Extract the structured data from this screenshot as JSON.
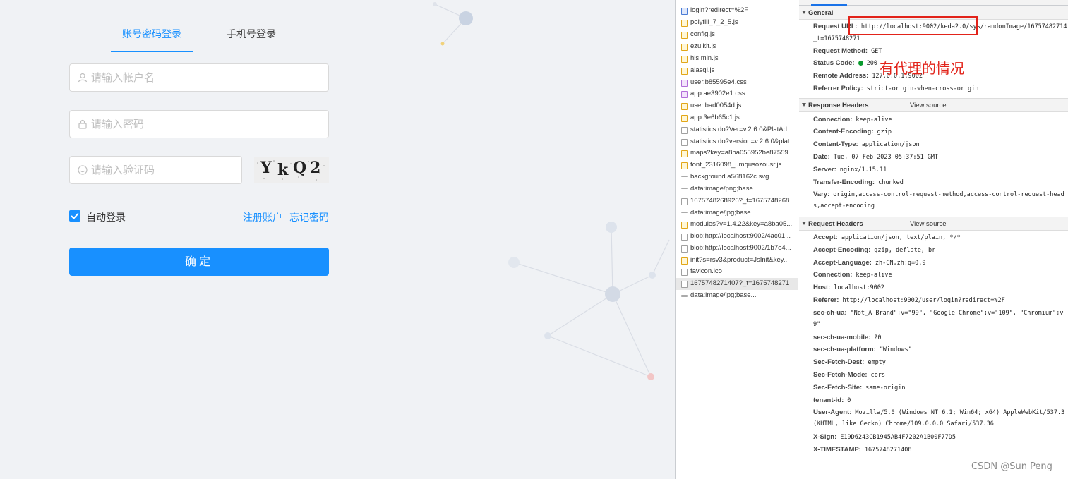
{
  "login": {
    "tabs": [
      {
        "label": "账号密码登录",
        "active": true
      },
      {
        "label": "手机号登录",
        "active": false
      }
    ],
    "username": {
      "placeholder": "请输入帐户名",
      "value": ""
    },
    "password": {
      "placeholder": "请输入密码",
      "value": ""
    },
    "captcha": {
      "placeholder": "请输入验证码",
      "value": "",
      "image_text": [
        "Y",
        "k",
        "Q",
        "2"
      ]
    },
    "remember": {
      "label": "自动登录",
      "checked": true
    },
    "register_link": "注册账户",
    "forgot_link": "忘记密码",
    "submit_label": "确定",
    "accent_color": "#1890ff"
  },
  "devtools": {
    "requests": [
      {
        "name": "login?redirect=%2F",
        "type": "doc"
      },
      {
        "name": "polyfill_7_2_5.js",
        "type": "script"
      },
      {
        "name": "config.js",
        "type": "script"
      },
      {
        "name": "ezuikit.js",
        "type": "script"
      },
      {
        "name": "hls.min.js",
        "type": "script"
      },
      {
        "name": "alasql.js",
        "type": "script"
      },
      {
        "name": "user.b85595e4.css",
        "type": "style"
      },
      {
        "name": "app.ae3902e1.css",
        "type": "style"
      },
      {
        "name": "user.bad0054d.js",
        "type": "script"
      },
      {
        "name": "app.3e6b65c1.js",
        "type": "script"
      },
      {
        "name": "statistics.do?Ver=v.2.6.0&PlatAd...",
        "type": "other"
      },
      {
        "name": "statistics.do?version=v.2.6.0&plat...",
        "type": "other"
      },
      {
        "name": "maps?key=a8ba055952be87559...",
        "type": "script"
      },
      {
        "name": "font_2316098_umqusozousr.js",
        "type": "script"
      },
      {
        "name": "background.a568162c.svg",
        "type": "img"
      },
      {
        "name": "data:image/png;base...",
        "type": "img"
      },
      {
        "name": "1675748268926?_t=1675748268",
        "type": "other"
      },
      {
        "name": "data:image/jpg;base...",
        "type": "img"
      },
      {
        "name": "modules?v=1.4.22&key=a8ba05...",
        "type": "script"
      },
      {
        "name": "blob:http://localhost:9002/4ac01...",
        "type": "other"
      },
      {
        "name": "blob:http://localhost:9002/1b7e4...",
        "type": "other"
      },
      {
        "name": "init?s=rsv3&product=JsInit&key...",
        "type": "script"
      },
      {
        "name": "favicon.ico",
        "type": "other"
      },
      {
        "name": "1675748271407?_t=1675748271",
        "type": "other",
        "selected": true
      },
      {
        "name": "data:image/jpg;base...",
        "type": "img"
      }
    ],
    "general": {
      "title": "General",
      "request_url_label": "Request URL:",
      "request_url": "http://localhost:9002/keda2.0/sys/randomImage/16757482714",
      "request_url_cont": "_t=1675748271",
      "method_label": "Request Method:",
      "method": "GET",
      "status_label": "Status Code:",
      "status": "200",
      "remote_label": "Remote Address:",
      "remote": "127.0.0.1:9002",
      "referrer_label": "Referrer Policy:",
      "referrer": "strict-origin-when-cross-origin"
    },
    "response_headers": {
      "title": "Response Headers",
      "view_source": "View source",
      "rows": [
        {
          "k": "Connection:",
          "v": "keep-alive"
        },
        {
          "k": "Content-Encoding:",
          "v": "gzip"
        },
        {
          "k": "Content-Type:",
          "v": "application/json"
        },
        {
          "k": "Date:",
          "v": "Tue, 07 Feb 2023 05:37:51 GMT"
        },
        {
          "k": "Server:",
          "v": "nginx/1.15.11"
        },
        {
          "k": "Transfer-Encoding:",
          "v": "chunked"
        },
        {
          "k": "Vary:",
          "v": "origin,access-control-request-method,access-control-request-head"
        }
      ],
      "vary_cont": "s,accept-encoding"
    },
    "request_headers": {
      "title": "Request Headers",
      "view_source": "View source",
      "rows": [
        {
          "k": "Accept:",
          "v": "application/json, text/plain, */*"
        },
        {
          "k": "Accept-Encoding:",
          "v": "gzip, deflate, br"
        },
        {
          "k": "Accept-Language:",
          "v": "zh-CN,zh;q=0.9"
        },
        {
          "k": "Connection:",
          "v": "keep-alive"
        },
        {
          "k": "Host:",
          "v": "localhost:9002"
        },
        {
          "k": "Referer:",
          "v": "http://localhost:9002/user/login?redirect=%2F"
        },
        {
          "k": "sec-ch-ua:",
          "v": "\"Not_A Brand\";v=\"99\", \"Google Chrome\";v=\"109\", \"Chromium\";v"
        },
        {
          "k": "",
          "v": "9\""
        },
        {
          "k": "sec-ch-ua-mobile:",
          "v": "?0"
        },
        {
          "k": "sec-ch-ua-platform:",
          "v": "\"Windows\""
        },
        {
          "k": "Sec-Fetch-Dest:",
          "v": "empty"
        },
        {
          "k": "Sec-Fetch-Mode:",
          "v": "cors"
        },
        {
          "k": "Sec-Fetch-Site:",
          "v": "same-origin"
        },
        {
          "k": "tenant-id:",
          "v": "0"
        },
        {
          "k": "User-Agent:",
          "v": "Mozilla/5.0 (Windows NT 6.1; Win64; x64) AppleWebKit/537.3"
        },
        {
          "k": "",
          "v": "(KHTML, like Gecko) Chrome/109.0.0.0 Safari/537.36"
        },
        {
          "k": "X-Sign:",
          "v": "E19D6243CB1945AB4F7202A1B00F77D5"
        },
        {
          "k": "X-TIMESTAMP:",
          "v": "1675748271408"
        }
      ]
    }
  },
  "annotation": "有代理的情况",
  "watermark": "CSDN @Sun   Peng",
  "highlight_color": "#e2231a"
}
